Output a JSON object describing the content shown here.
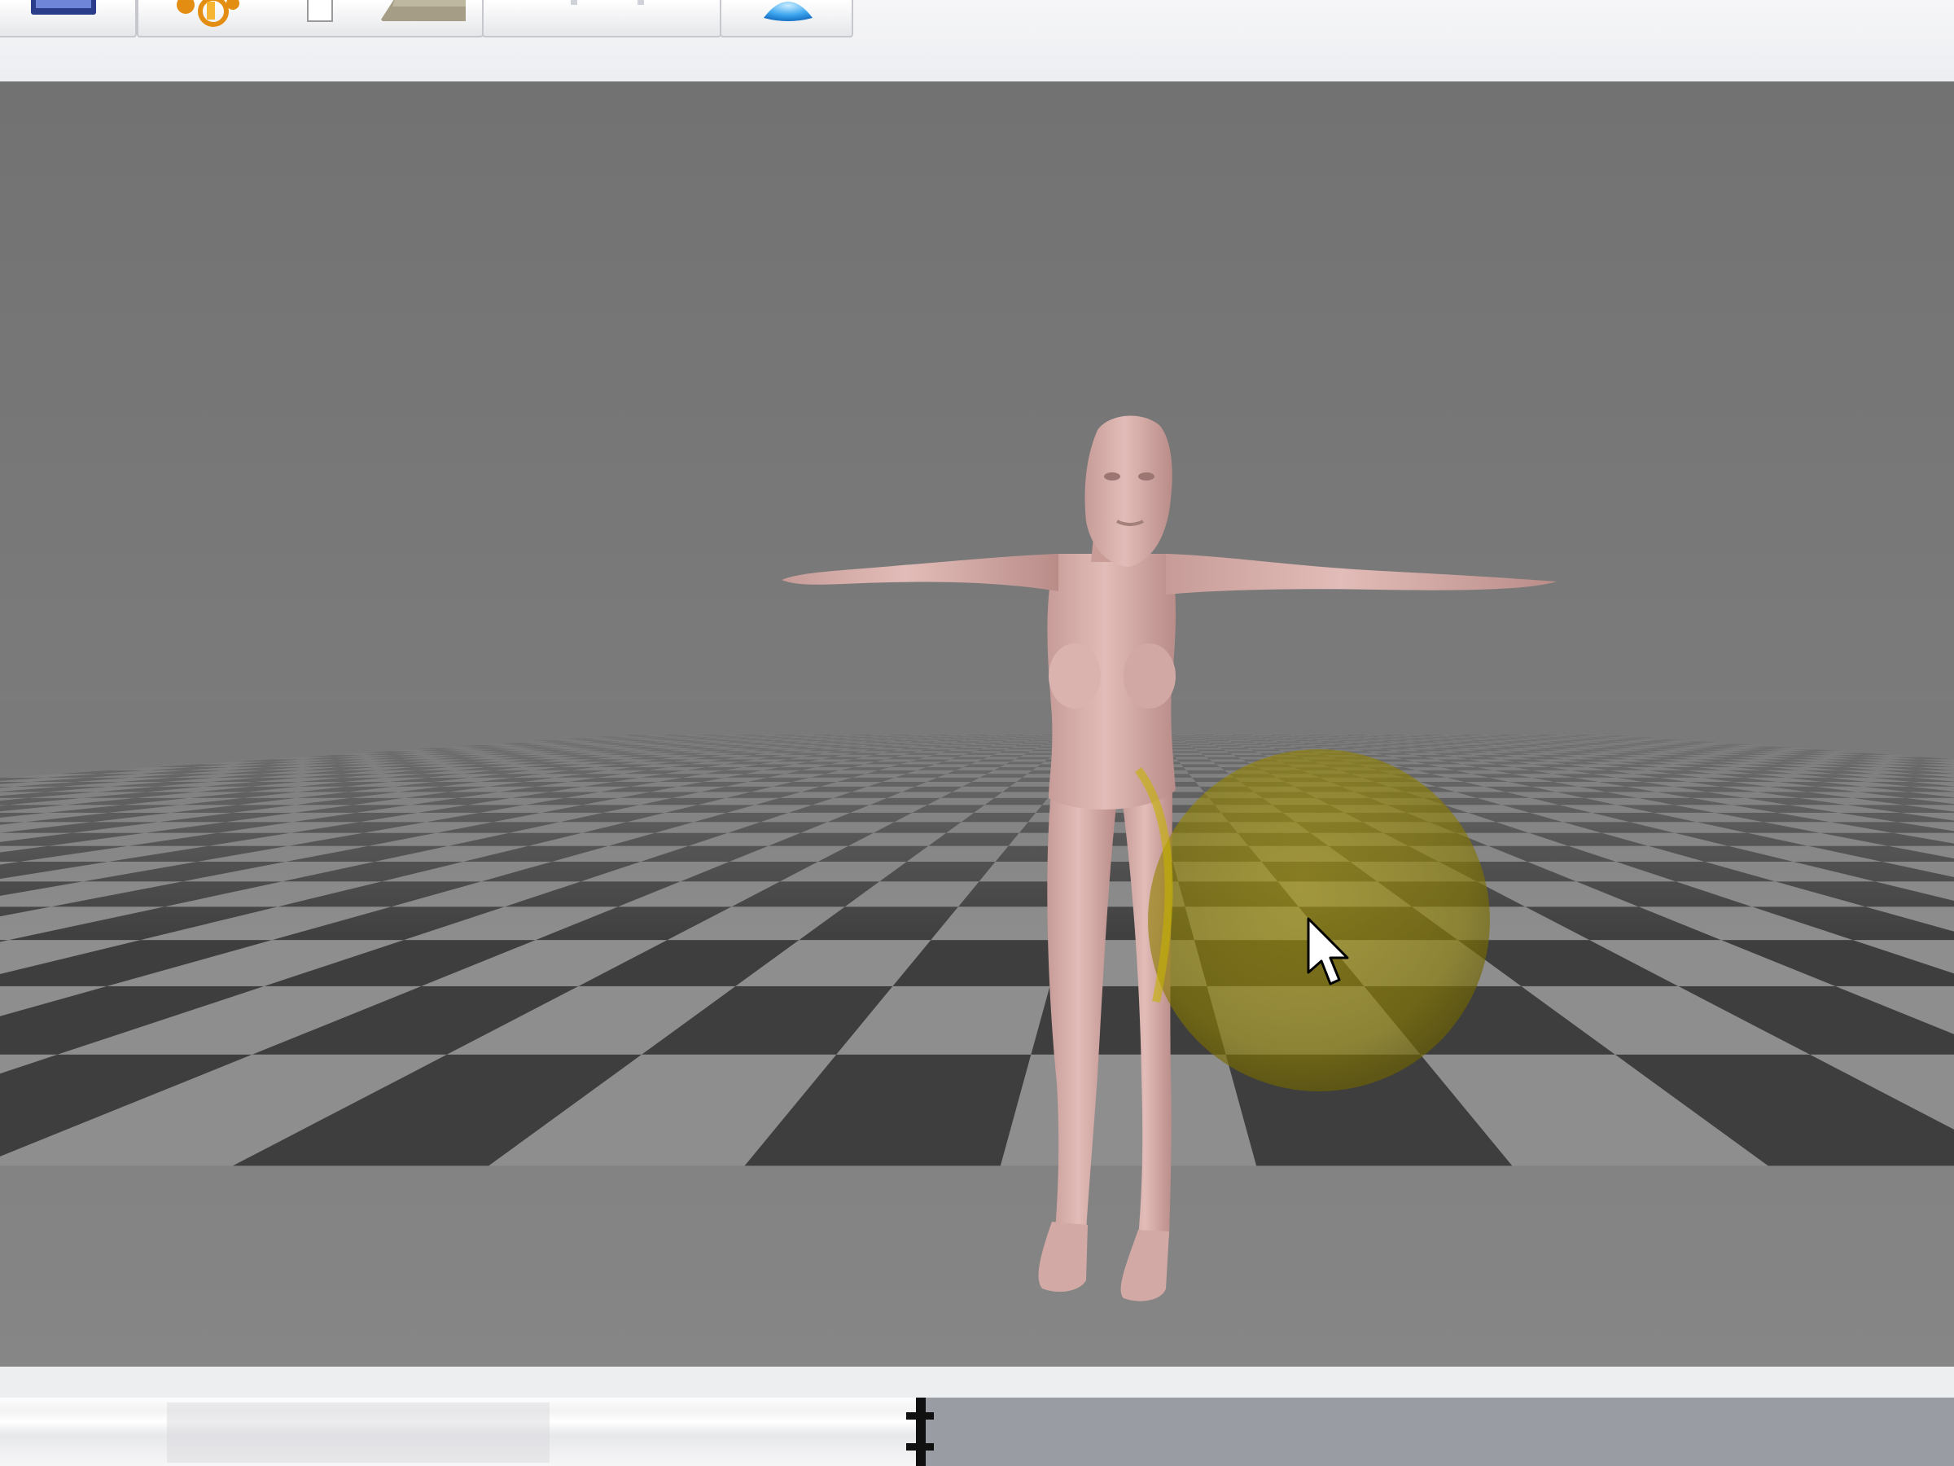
{
  "app": {
    "toolbar": {
      "groups": [
        {
          "id": "file-group",
          "buttons": [
            {
              "icon": "picture-frame-icon"
            }
          ]
        },
        {
          "id": "tools-group",
          "buttons": [
            {
              "icon": "move-joint-icon"
            },
            {
              "icon": "page-icon"
            },
            {
              "icon": "floor-tile-icon"
            }
          ]
        },
        {
          "id": "view-group",
          "buttons": [
            {
              "icon": "dot-icon"
            },
            {
              "icon": "dot-icon"
            }
          ]
        },
        {
          "id": "render-group",
          "buttons": [
            {
              "icon": "blue-dome-icon"
            }
          ]
        }
      ]
    },
    "viewport": {
      "background_color": "#737373",
      "floor": {
        "pattern": "checkerboard",
        "light_color": "#8e8e8e",
        "dark_color": "#3e3e3e"
      },
      "figure": {
        "pose": "T-pose",
        "skin_color": "#d6aaa6"
      },
      "brush_cursor": {
        "shape": "sphere",
        "color": "#b8a400",
        "opacity": 0.65
      }
    },
    "timeline": {
      "playhead_fraction": 0.471
    }
  },
  "colors": {
    "toolbar_bg": "#eef0f2",
    "timeline_track": "#9a9ca3",
    "playhead": "#101010"
  }
}
